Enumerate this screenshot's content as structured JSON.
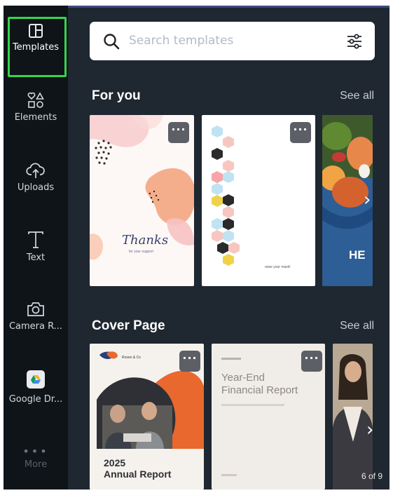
{
  "sidebar": {
    "items": [
      {
        "label": "Templates",
        "icon": "templates-icon"
      },
      {
        "label": "Elements",
        "icon": "elements-icon"
      },
      {
        "label": "Uploads",
        "icon": "upload-cloud-icon"
      },
      {
        "label": "Text",
        "icon": "text-icon"
      },
      {
        "label": "Camera R...",
        "icon": "camera-icon"
      },
      {
        "label": "Google Dr...",
        "icon": "google-drive-icon"
      },
      {
        "label": "More",
        "icon": "more-dots-icon"
      }
    ],
    "active_color": "#36d44c"
  },
  "search": {
    "placeholder": "Search templates"
  },
  "sections": [
    {
      "title": "For you",
      "see_all": "See all",
      "cards": [
        {
          "name": "thanks-card",
          "text": "Thanks",
          "subtext": "for your support",
          "more": "···"
        },
        {
          "name": "hexagon-card",
          "text": "raise your mask!",
          "more": "···"
        },
        {
          "name": "food-card",
          "text": "HE"
        }
      ]
    },
    {
      "title": "Cover Page",
      "see_all": "See all",
      "cards": [
        {
          "name": "annual-report-card",
          "brand": "Rosen & Co",
          "year": "2025",
          "title": "Annual Report",
          "more": "···"
        },
        {
          "name": "financial-report-card",
          "title_line1": "Year-End",
          "title_line2": "Financial Report",
          "more": "···"
        },
        {
          "name": "portrait-card"
        }
      ],
      "page_count": "6 of 9"
    }
  ],
  "colors": {
    "sidebar_bg": "#0f1419",
    "panel_bg": "#1f2731",
    "more_btn": "#5d5f66"
  }
}
